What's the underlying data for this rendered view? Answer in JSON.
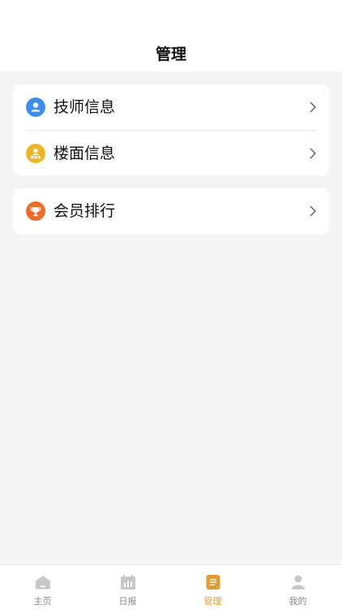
{
  "header": {
    "title": "管理"
  },
  "menu": {
    "group1": [
      {
        "label": "技师信息",
        "icon": "user-icon",
        "icon_color": "#3b8ef0"
      },
      {
        "label": "楼面信息",
        "icon": "group-icon",
        "icon_color": "#f0b51e"
      }
    ],
    "group2": [
      {
        "label": "会员排行",
        "icon": "trophy-icon",
        "icon_color": "#f26a26"
      }
    ]
  },
  "tabbar": {
    "items": [
      {
        "label": "主页",
        "icon": "home-icon",
        "active": false
      },
      {
        "label": "日报",
        "icon": "report-icon",
        "active": false
      },
      {
        "label": "管理",
        "icon": "manage-icon",
        "active": true
      },
      {
        "label": "我的",
        "icon": "profile-icon",
        "active": false
      }
    ],
    "active_color": "#e89a2c",
    "inactive_color": "#c8c8c8"
  }
}
